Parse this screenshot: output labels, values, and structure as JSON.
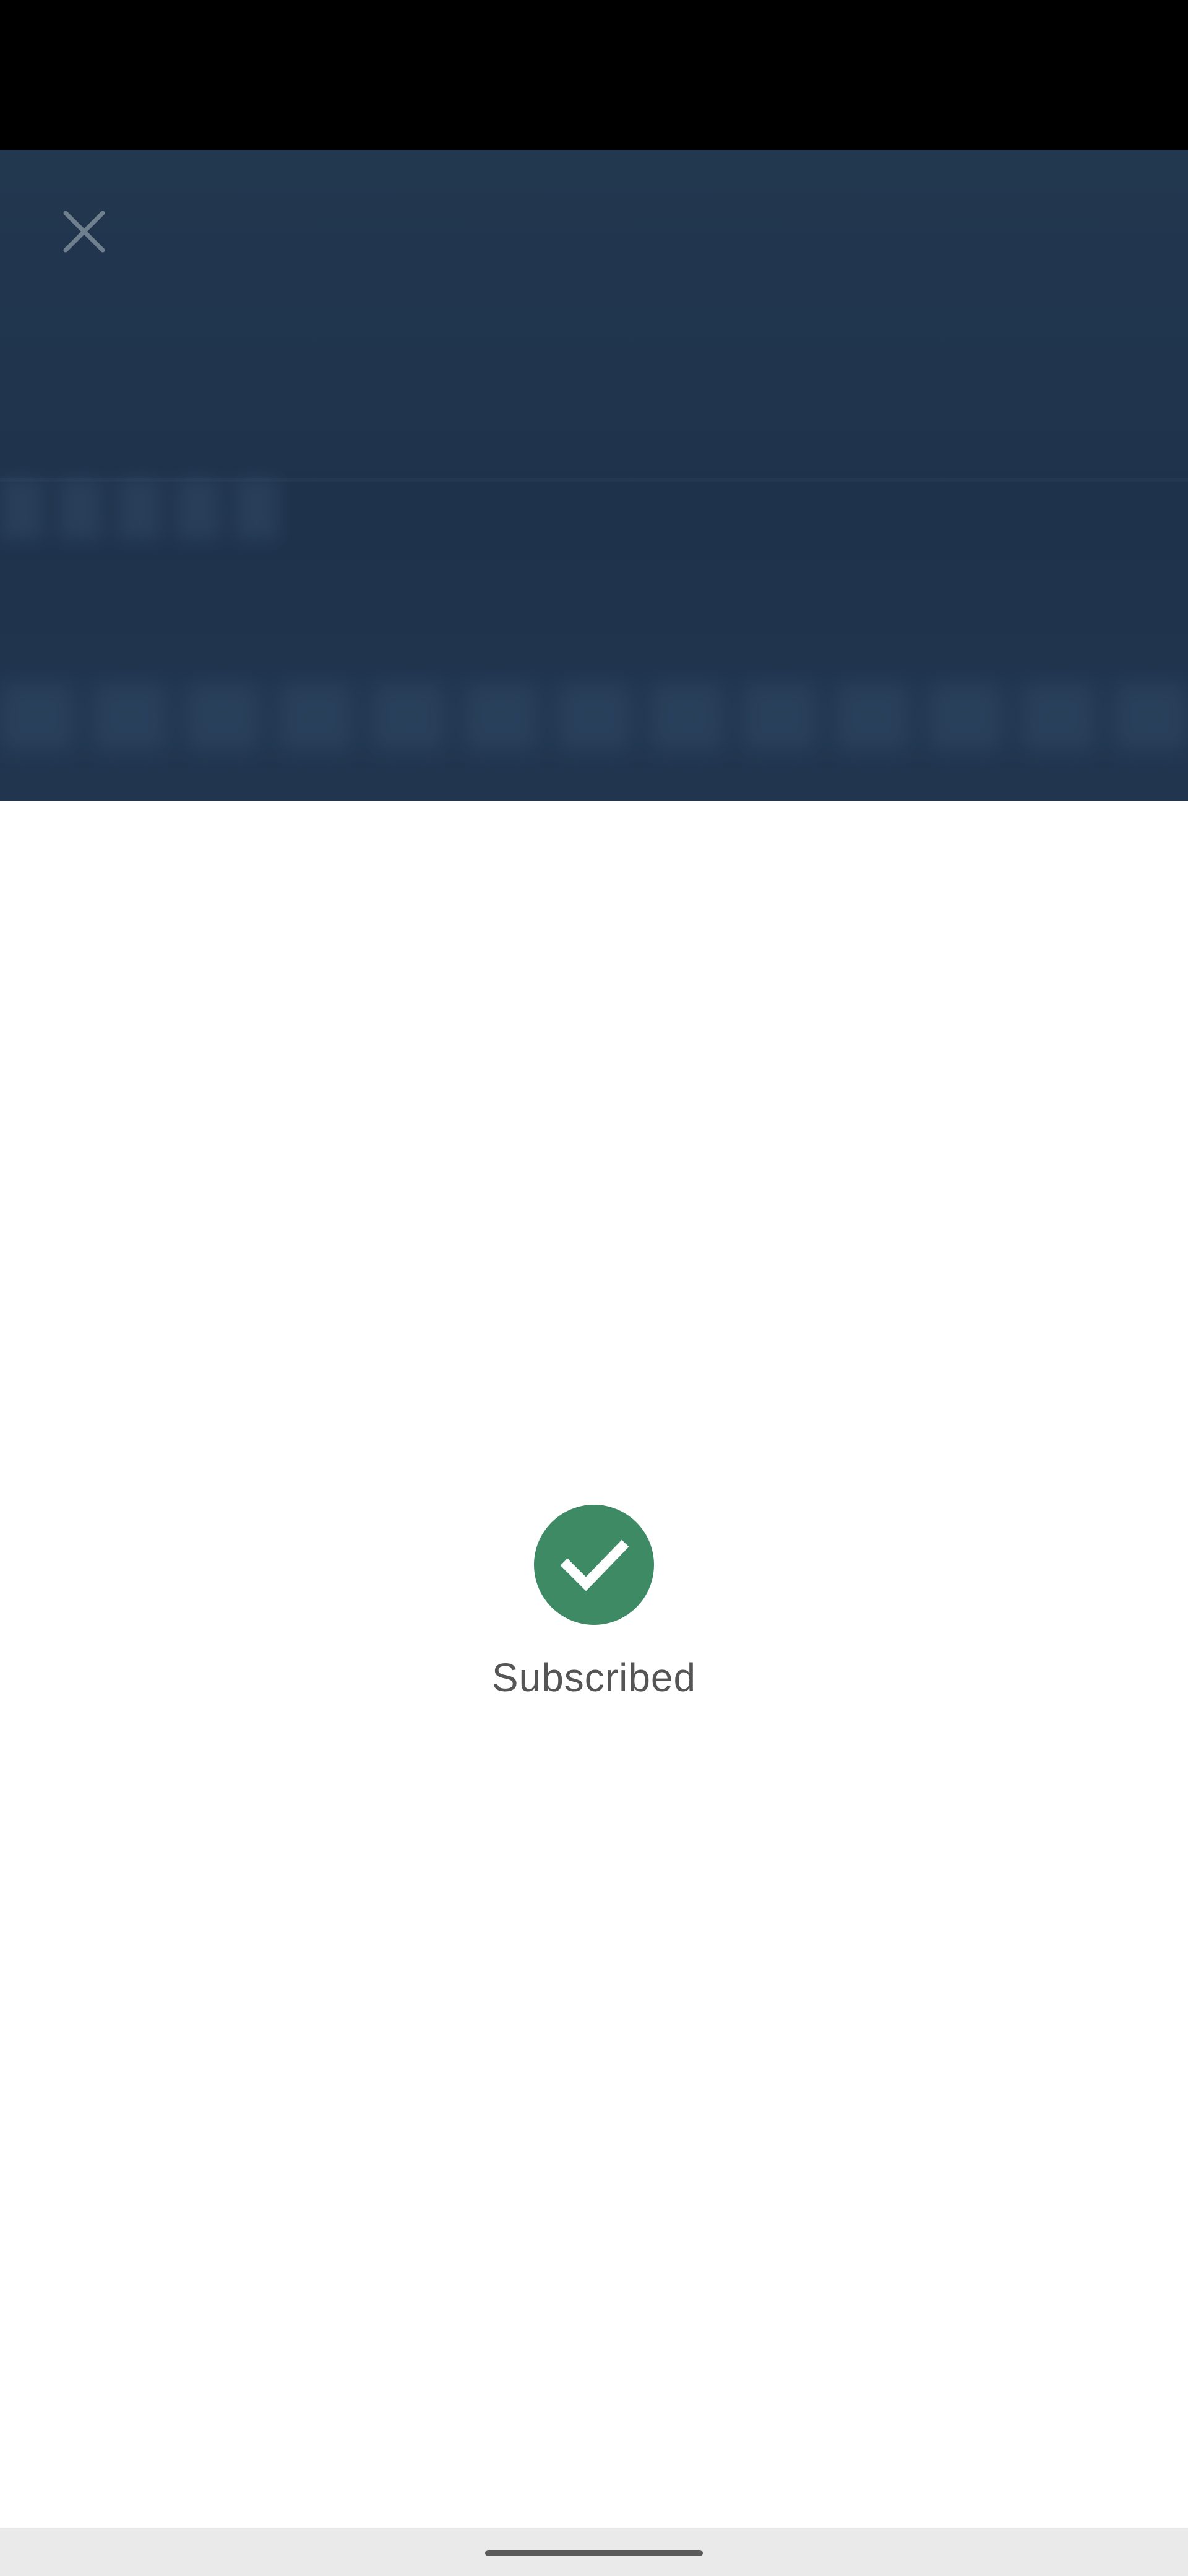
{
  "status": {
    "label": "Subscribed",
    "icon": "check-circle-icon",
    "color": "#3d8a64"
  },
  "header": {
    "close_icon": "close-icon",
    "background": "#1f324c"
  },
  "colors": {
    "status_bar": "#000000",
    "nav_bar": "#eaeaea",
    "text": "#555555"
  }
}
